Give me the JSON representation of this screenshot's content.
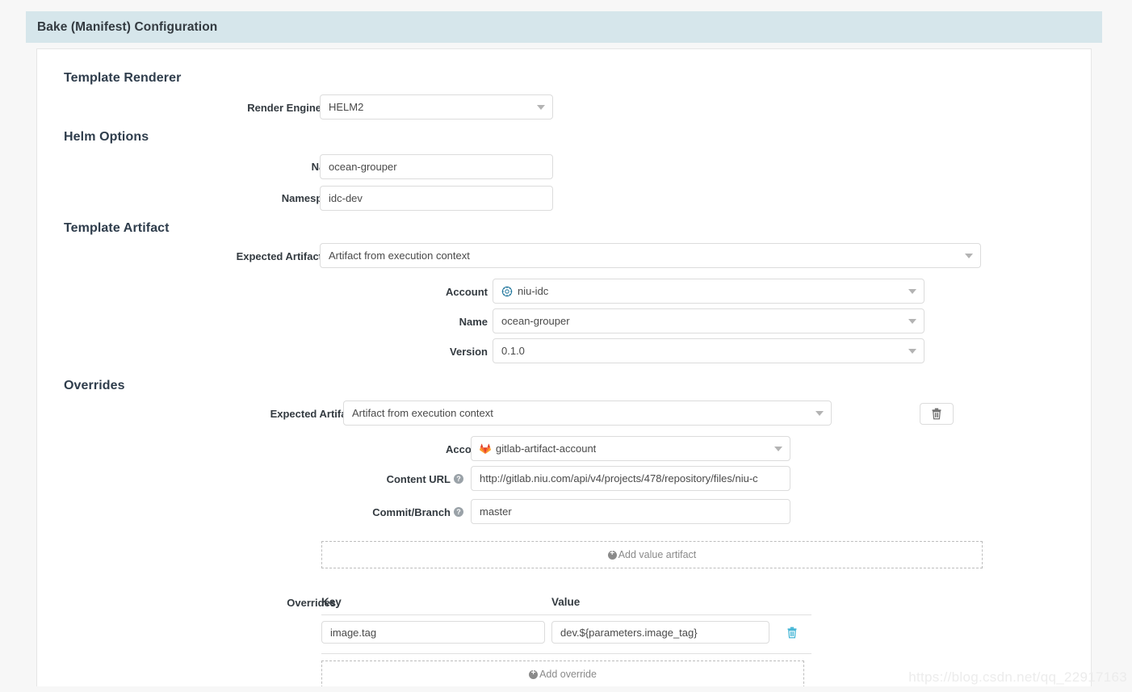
{
  "header": {
    "title": "Bake (Manifest) Configuration"
  },
  "sections": {
    "template_renderer": "Template Renderer",
    "helm_options": "Helm Options",
    "template_artifact": "Template Artifact",
    "overrides": "Overrides"
  },
  "template_renderer": {
    "render_engine_label": "Render Engine",
    "render_engine_value": "HELM2",
    "help_glyph": "?"
  },
  "helm_options": {
    "name_label": "Name",
    "name_value": "ocean-grouper",
    "namespace_label": "Namespace",
    "namespace_value": "idc-dev"
  },
  "template_artifact": {
    "expected_artifact_label": "Expected Artifact",
    "expected_artifact_value": "Artifact from execution context",
    "account_label": "Account",
    "account_value": "niu-idc",
    "account_icon": "helm-icon",
    "name_label": "Name",
    "name_value": "ocean-grouper",
    "version_label": "Version",
    "version_value": "0.1.0"
  },
  "overrides": {
    "expected_artifact_label": "Expected Artifact",
    "expected_artifact_value": "Artifact from execution context",
    "delete_artifact_icon": "trash-icon",
    "account_label": "Account",
    "account_value": "gitlab-artifact-account",
    "account_icon": "gitlab-icon",
    "content_url_label": "Content URL",
    "content_url_value": "http://gitlab.niu.com/api/v4/projects/478/repository/files/niu-c",
    "commit_branch_label": "Commit/Branch",
    "commit_branch_value": "master",
    "add_value_artifact_label": "Add value artifact",
    "overrides_label": "Overrides",
    "table": {
      "columns": [
        "Key",
        "Value"
      ],
      "rows": [
        {
          "key": "image.tag",
          "value": "dev.${parameters.image_tag}"
        }
      ],
      "row_delete_icon": "trash-icon"
    },
    "add_override_label": "Add override"
  },
  "watermark": "https://blog.csdn.net/qq_22917163",
  "colors": {
    "header_bg": "#d6e6eb",
    "page_bg": "#f7f7f7",
    "panel_bg": "#ffffff",
    "heading": "#2f3d4c",
    "border": "#dcdcdc",
    "trash_accent": "#45b6d6",
    "gitlab_orange": "#e2432a",
    "helm_blue": "#277a9f"
  }
}
